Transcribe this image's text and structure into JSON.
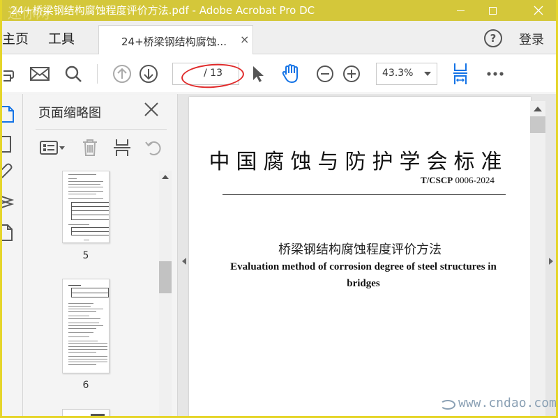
{
  "window": {
    "title": "24+桥梁钢结构腐蚀程度评价方法.pdf - Adobe Acrobat Pro DC",
    "watermark_top_left": "迷你网",
    "accent_color": "#d4c73a",
    "controls": [
      "minimize",
      "maximize",
      "close"
    ]
  },
  "menu": {
    "home_label": "主页",
    "tools_label": "工具",
    "doc_tab_label": "24+桥梁钢结构腐蚀...",
    "doc_tab_close": "×",
    "help_label": "?",
    "login_label": "登录"
  },
  "toolbar": {
    "icons": [
      "print-icon",
      "email-icon",
      "search-icon",
      "previous-page-icon",
      "next-page-icon",
      "select-cursor-icon",
      "hand-tool-icon",
      "zoom-out-icon",
      "zoom-in-icon",
      "fit-page-icon",
      "more-icon"
    ],
    "page_current": "",
    "page_total": "/ 13",
    "zoom": "43.3%",
    "tool_highlight_color": "#1473e6"
  },
  "thumbnails": {
    "title": "页面缩略图",
    "tool_icons": [
      "options-icon",
      "delete-icon",
      "insert-page-icon",
      "rotate-icon"
    ],
    "pages": [
      {
        "number": "5"
      },
      {
        "number": "6"
      }
    ]
  },
  "document": {
    "standard_title": "中国腐蚀与防护学会标准",
    "standard_code_prefix": "T/CSCP",
    "standard_code_number": "0006-2024",
    "chinese_name": "桥梁钢结构腐蚀程度评价方法",
    "english_name": "Evaluation method of corrosion degree of steel structures in bridges"
  },
  "watermark_bottom_right": "www.cndao.com"
}
